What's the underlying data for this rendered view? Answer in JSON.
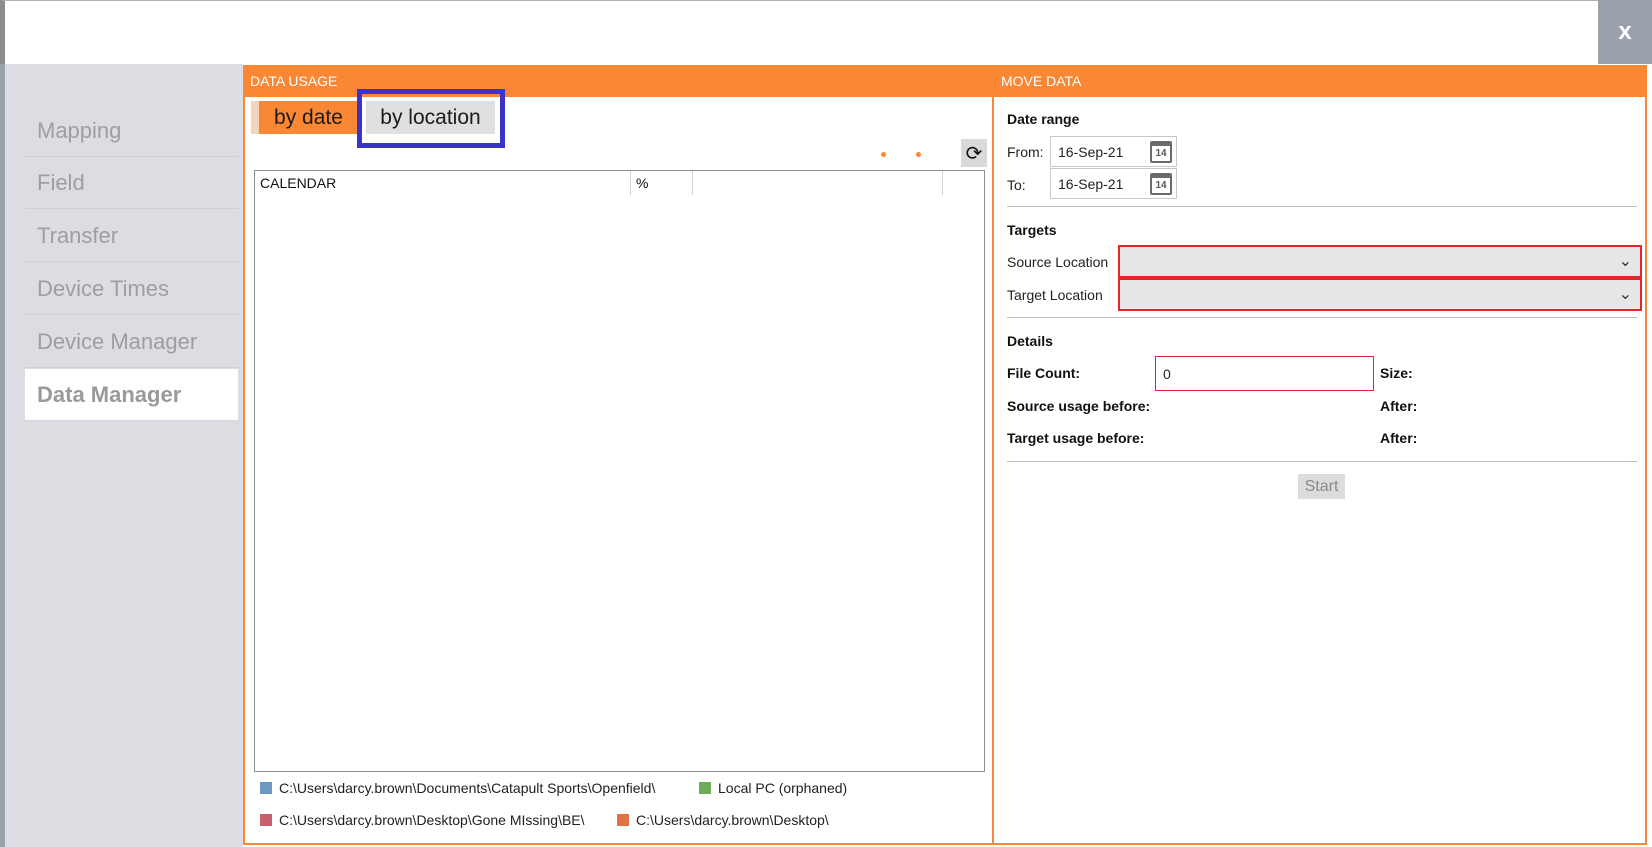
{
  "window": {
    "close_label": "x"
  },
  "sidebar": {
    "items": [
      {
        "label": "Mapping"
      },
      {
        "label": "Field"
      },
      {
        "label": "Transfer"
      },
      {
        "label": "Device Times"
      },
      {
        "label": "Device Manager"
      },
      {
        "label": "Data Manager",
        "active": true
      }
    ]
  },
  "data_usage": {
    "header": "DATA USAGE",
    "tabs": [
      {
        "label": "by date",
        "active": true
      },
      {
        "label": "by location",
        "highlighted": true
      }
    ],
    "table": {
      "columns": [
        "CALENDAR",
        "%",
        "",
        ""
      ]
    },
    "legend": [
      {
        "label": "C:\\Users\\darcy.brown\\Documents\\Catapult Sports\\Openfield\\",
        "color": "#6d98c2"
      },
      {
        "label": "Local PC (orphaned)",
        "color": "#6dab5a"
      },
      {
        "label": "C:\\Users\\darcy.brown\\Desktop\\Gone MIssing\\BE\\",
        "color": "#c8616d"
      },
      {
        "label": "C:\\Users\\darcy.brown\\Desktop\\",
        "color": "#de7248"
      }
    ],
    "refresh_icon": "refresh-icon"
  },
  "move_data": {
    "header": "MOVE DATA",
    "date_range": {
      "title": "Date range",
      "from_label": "From:",
      "from_value": "16-Sep-21",
      "to_label": "To:",
      "to_value": "16-Sep-21",
      "calendar_icon_text": "14"
    },
    "targets": {
      "title": "Targets",
      "source_label": "Source Location",
      "source_value": "",
      "target_label": "Target Location",
      "target_value": ""
    },
    "details": {
      "title": "Details",
      "file_count_label": "File Count:",
      "file_count_value": "0",
      "size_label": "Size:",
      "source_before_label": "Source usage before:",
      "source_after_label": "After:",
      "target_before_label": "Target usage before:",
      "target_after_label": "After:"
    },
    "start_label": "Start"
  },
  "colors": {
    "accent": "#fa8734",
    "highlight_outline": "#3a34c8",
    "error_border": "#e3262a"
  }
}
